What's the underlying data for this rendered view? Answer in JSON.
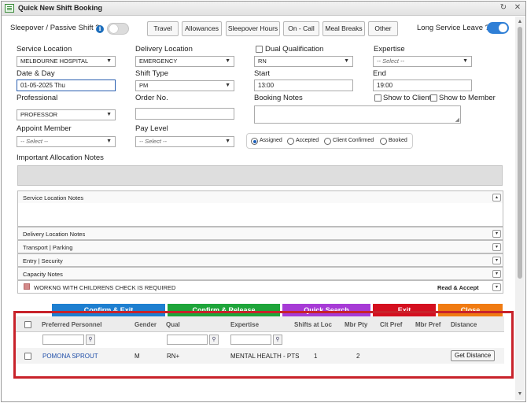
{
  "window": {
    "title": "Quick New Shift Booking",
    "controls": {
      "restore_icon": "↻",
      "close_icon": "✕"
    }
  },
  "top": {
    "sleepover_label": "Sleepover / Passive Shift ?",
    "sleepover_on": false,
    "info_icon": "i",
    "long_service_label": "Long Service Leave ?",
    "long_service_on": true,
    "buttons": [
      "Travel",
      "Allowances",
      "Sleepover Hours",
      "On - Call",
      "Meal Breaks",
      "Other"
    ]
  },
  "form": {
    "service_location": {
      "label": "Service Location",
      "value": "MELBOURNE HOSPITAL"
    },
    "delivery_location": {
      "label": "Delivery Location",
      "value": "EMERGENCY"
    },
    "dual_qualification": {
      "label": "Dual Qualification",
      "checked": false,
      "value": "RN"
    },
    "expertise": {
      "label": "Expertise",
      "placeholder": "-- Select --"
    },
    "date_day": {
      "label": "Date & Day",
      "value": "01-05-2025 Thu"
    },
    "shift_type": {
      "label": "Shift Type",
      "value": "PM"
    },
    "start": {
      "label": "Start",
      "value": "13:00"
    },
    "end": {
      "label": "End",
      "value": "19:00"
    },
    "professional": {
      "label": "Professional",
      "value": "PROFESSOR"
    },
    "order_no": {
      "label": "Order No.",
      "value": ""
    },
    "booking_notes": {
      "label": "Booking Notes",
      "value": ""
    },
    "show_to_client": {
      "label": "Show to Client",
      "checked": false
    },
    "show_to_member": {
      "label": "Show to Member",
      "checked": false
    },
    "appoint_member": {
      "label": "Appoint Member",
      "placeholder": "-- Select --"
    },
    "pay_level": {
      "label": "Pay Level",
      "placeholder": "-- Select --"
    },
    "status_options": [
      "Assigned",
      "Accepted",
      "Client Confirmed",
      "Booked"
    ],
    "status_selected": "Assigned",
    "important_allocation_notes_label": "Important Allocation Notes"
  },
  "panels": {
    "service_location_notes": "Service Location Notes",
    "delivery_location_notes": "Delivery Location Notes",
    "transport_parking": "Transport | Parking",
    "entry_security": "Entry | Security",
    "capacity_notes": "Capacity Notes",
    "wwcc_required": "WORKNG WITH CHILDRENS CHECK IS REQUIRED",
    "read_accept": "Read & Accept",
    "expand_icon": "▾",
    "collapse_icon": "▴"
  },
  "actions": {
    "confirm_exit": {
      "label": "Confirm & Exit",
      "color": "#1e7fd0"
    },
    "confirm_release": {
      "label": "Confirm & Release",
      "color": "#1ea53a"
    },
    "quick_search": {
      "label": "Quick Search",
      "color": "#a73bd6"
    },
    "exit": {
      "label": "Exit",
      "color": "#d40f1f"
    },
    "close": {
      "label": "Close",
      "color": "#f07b12"
    }
  },
  "grid": {
    "columns": [
      "Preferred Personnel",
      "Gender",
      "Qual",
      "Expertise",
      "Shifts at Loc",
      "Mbr Pty",
      "Clt Pref",
      "Mbr Pref",
      "Distance"
    ],
    "filter_icon": "⚲",
    "rows": [
      {
        "name": "POMONA SPROUT",
        "gender": "M",
        "qual": "RN+",
        "expertise": "MENTAL HEALTH - PTS",
        "shifts_at_loc": "1",
        "mbr_pty": "2",
        "clt_pref": "",
        "mbr_pref": "",
        "distance_button": "Get Distance"
      }
    ]
  },
  "colors": {
    "highlight": "#c8222a",
    "toggle_on": "#2f7fd6",
    "link": "#1f4ea8"
  }
}
